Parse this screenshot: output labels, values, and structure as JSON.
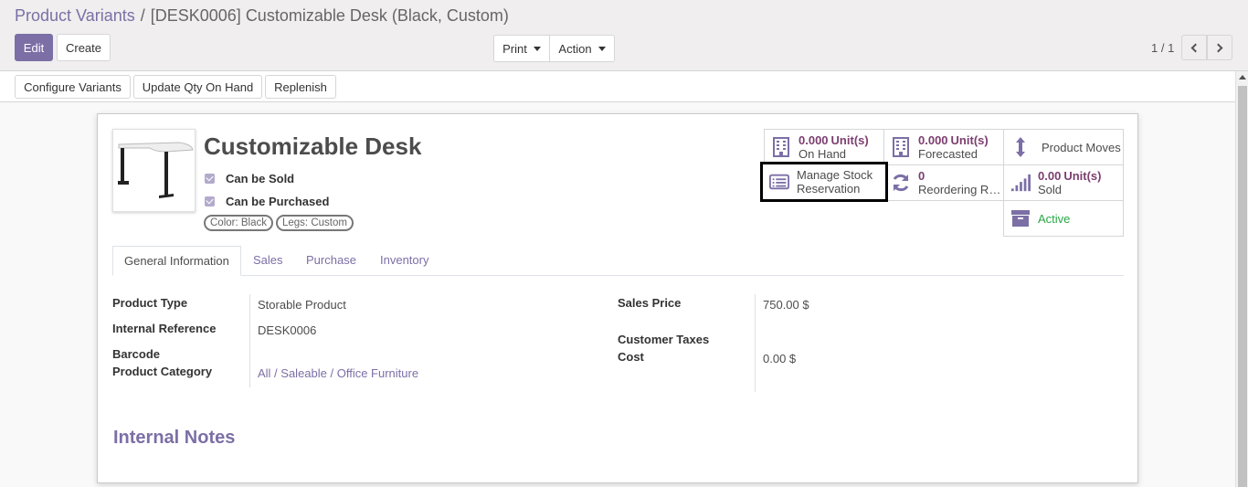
{
  "breadcrumb": {
    "parent": "Product Variants",
    "separator": "/",
    "current": "[DESK0006] Customizable Desk (Black, Custom)"
  },
  "toolbar": {
    "edit_label": "Edit",
    "create_label": "Create",
    "print_label": "Print",
    "action_label": "Action"
  },
  "pager": {
    "value": "1 / 1"
  },
  "statusbar": {
    "configure_variants": "Configure Variants",
    "update_qty": "Update Qty On Hand",
    "replenish": "Replenish"
  },
  "product": {
    "name": "Customizable Desk",
    "can_be_sold_label": "Can be Sold",
    "can_be_purchased_label": "Can be Purchased",
    "tags": [
      "Color: Black",
      "Legs: Custom"
    ]
  },
  "smart_buttons": {
    "on_hand": {
      "value": "0.000",
      "unit": "Unit(s)",
      "label": "On Hand",
      "icon": "building-icon"
    },
    "forecasted": {
      "value": "0.000",
      "unit": "Unit(s)",
      "label": "Forecasted",
      "icon": "building-icon"
    },
    "product_moves": {
      "label": "Product Moves",
      "icon": "arrows-v-icon"
    },
    "manage_stock": {
      "line1": "Manage Stock",
      "line2": "Reservation",
      "icon": "list-alt-icon"
    },
    "reordering": {
      "value": "0",
      "label": "Reordering R…",
      "icon": "refresh-icon"
    },
    "sold": {
      "value": "0.00",
      "unit": "Unit(s)",
      "label": "Sold",
      "icon": "signal-icon"
    },
    "active": {
      "label": "Active",
      "icon": "archive-icon"
    }
  },
  "tabs": [
    "General Information",
    "Sales",
    "Purchase",
    "Inventory"
  ],
  "fields": {
    "product_type": {
      "label": "Product Type",
      "value": "Storable Product"
    },
    "internal_reference": {
      "label": "Internal Reference",
      "value": "DESK0006"
    },
    "barcode": {
      "label": "Barcode",
      "value": ""
    },
    "product_category": {
      "label": "Product Category",
      "value": "All / Saleable / Office Furniture"
    },
    "sales_price": {
      "label": "Sales Price",
      "value": "750.00 $"
    },
    "customer_taxes": {
      "label": "Customer Taxes",
      "value": ""
    },
    "cost": {
      "label": "Cost",
      "value": "0.00 $"
    }
  },
  "internal_notes_title": "Internal Notes",
  "colors": {
    "primary": "#7c6fa6",
    "value_accent": "#7c3e6f",
    "success": "#28a745"
  }
}
